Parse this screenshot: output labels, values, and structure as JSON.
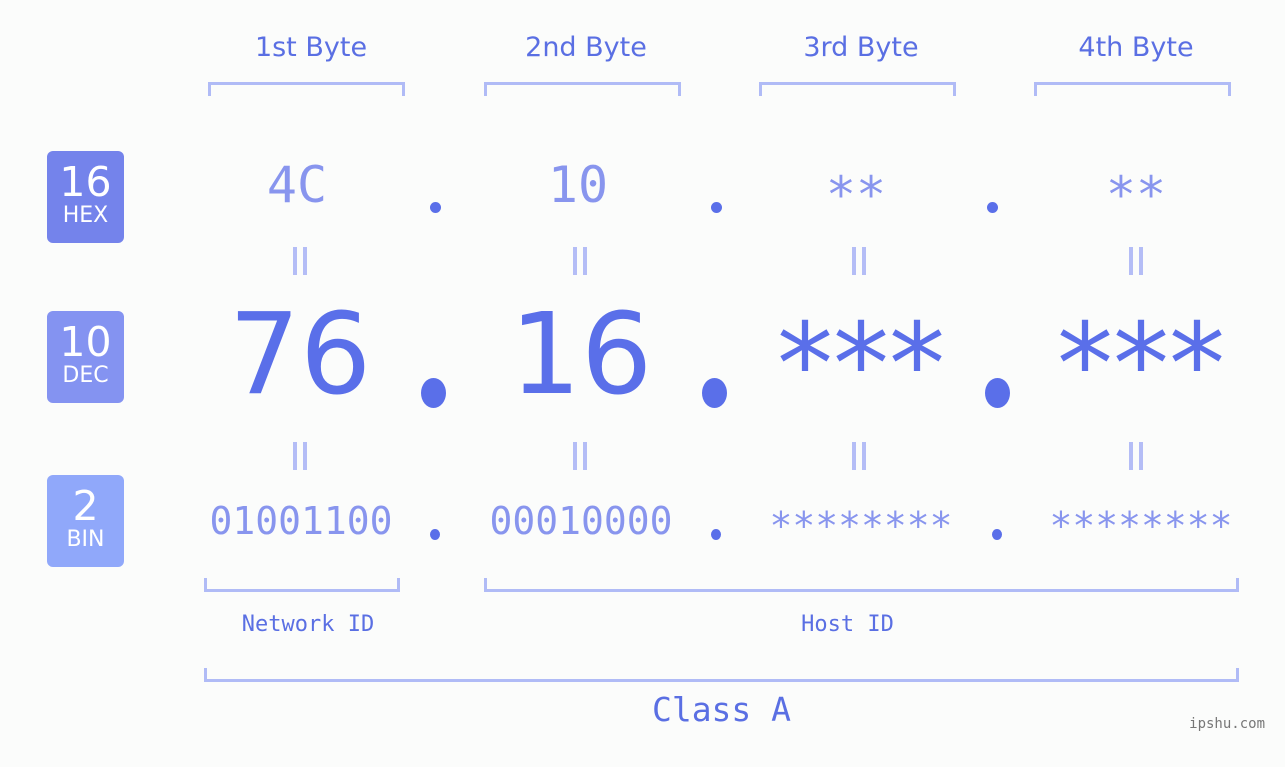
{
  "bytes": [
    {
      "label": "1st Byte",
      "hex": "4C",
      "dec": "76",
      "bin": "01001100"
    },
    {
      "label": "2nd Byte",
      "hex": "10",
      "dec": "16",
      "bin": "00010000"
    },
    {
      "label": "3rd Byte",
      "hex": "**",
      "dec": "***",
      "bin": "********"
    },
    {
      "label": "4th Byte",
      "hex": "**",
      "dec": "***",
      "bin": "********"
    }
  ],
  "bases": [
    {
      "num": "16",
      "name": "HEX",
      "color": "#7483eb"
    },
    {
      "num": "10",
      "name": "DEC",
      "color": "#8493f1"
    },
    {
      "num": "2",
      "name": "BIN",
      "color": "#90a8fa"
    }
  ],
  "segments": {
    "network": "Network ID",
    "host": "Host ID"
  },
  "class_label": "Class A",
  "watermark": "ipshu.com",
  "colors": {
    "accent": "#5a6fe9",
    "light_value": "#8895ee",
    "bracket": "#b0bbf6"
  }
}
